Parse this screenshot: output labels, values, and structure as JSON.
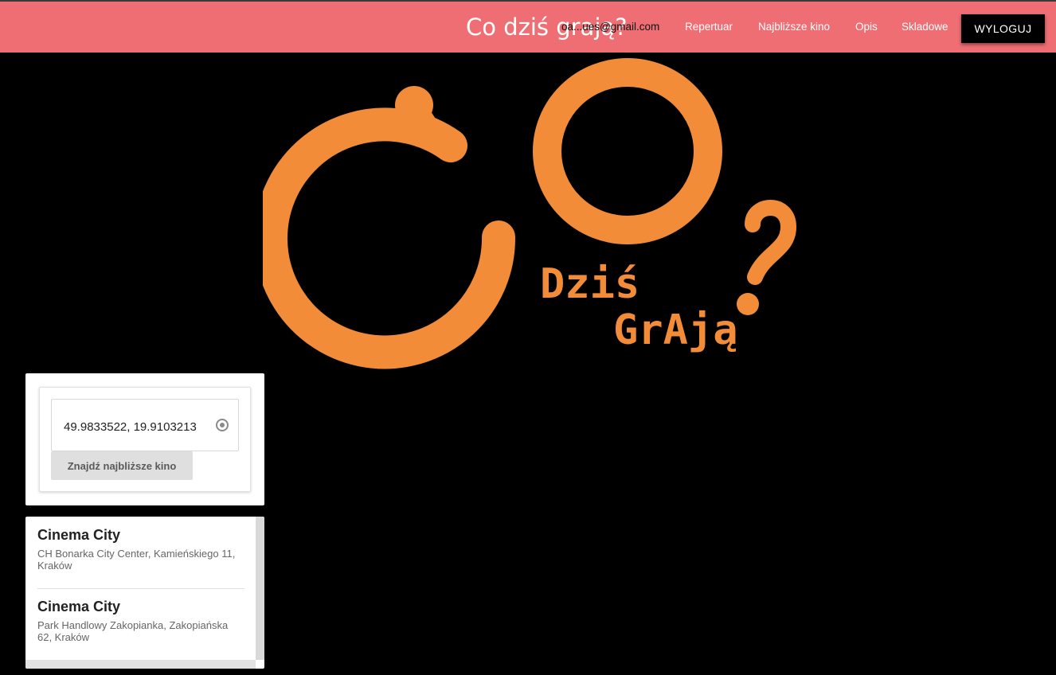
{
  "navbar": {
    "brand": "Co dziś grają?",
    "email": "oa...ues@gmail.com",
    "links": [
      "Repertuar",
      "Najbliższe kino",
      "Opis",
      "Skladowe"
    ],
    "logout": "WYLOGUJ",
    "background": "#ee6e73"
  },
  "logo": {
    "line1": "Dziś",
    "line2": "GrAją",
    "color": "#f28c38"
  },
  "search": {
    "coordinates": "49.9833522, 19.9103213",
    "button": "Znajdź najbliższe kino"
  },
  "results": [
    {
      "name": "Cinema City",
      "address": "CH Bonarka City Center, Kamieńskiego 11, Kraków"
    },
    {
      "name": "Cinema City",
      "address": "Park Handlowy Zakopianka, Zakopiańska 62, Kraków"
    }
  ]
}
